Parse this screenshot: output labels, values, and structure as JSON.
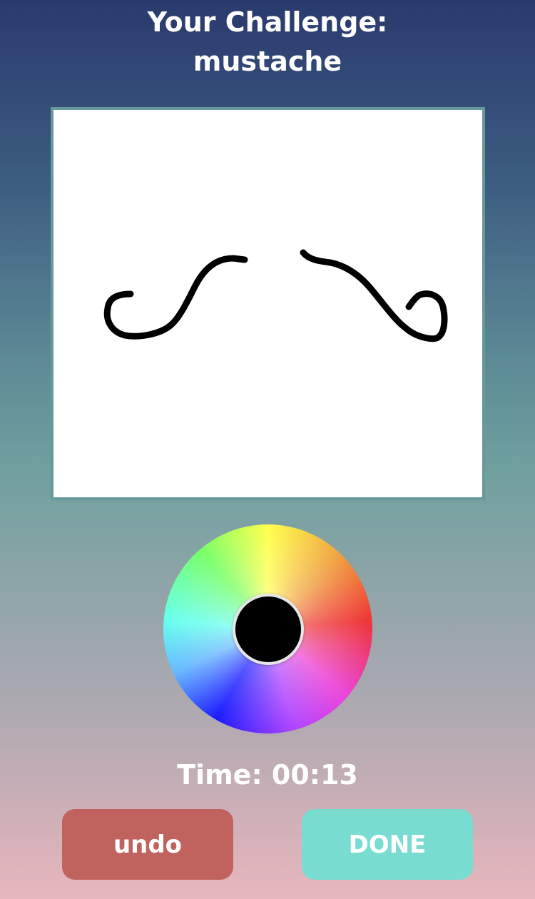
{
  "header": {
    "title_line1": "Your Challenge:",
    "challenge_word": "mustache"
  },
  "canvas": {
    "background_color": "#ffffff",
    "border_color": "#66999b",
    "stroke_color": "#000000"
  },
  "color_picker": {
    "selected_color": "#000000",
    "ring_color": "#e6e6e6"
  },
  "timer": {
    "text": "Time: 00:13"
  },
  "buttons": {
    "undo_label": "undo",
    "undo_color": "#c0625e",
    "done_label": "DONE",
    "done_color": "#78ddd0"
  }
}
